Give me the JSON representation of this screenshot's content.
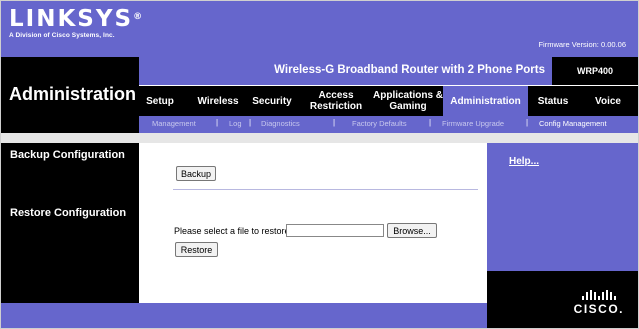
{
  "brand": {
    "logo_text": "LINKSYS",
    "registered": "®",
    "subtitle": "A Division of Cisco Systems, Inc."
  },
  "header": {
    "firmware": "Firmware Version: 0.00.06"
  },
  "product": {
    "name": "Wireless-G Broadband Router with 2 Phone Ports",
    "model": "WRP400"
  },
  "page": {
    "title": "Administration"
  },
  "tabs": [
    {
      "label": "Setup"
    },
    {
      "label": "Wireless"
    },
    {
      "label": "Security"
    },
    {
      "label": "Access Restriction"
    },
    {
      "label": "Applications & Gaming"
    },
    {
      "label": "Administration",
      "active": true
    },
    {
      "label": "Status"
    },
    {
      "label": "Voice"
    }
  ],
  "subtabs": [
    {
      "label": "Management"
    },
    {
      "label": "Log"
    },
    {
      "label": "Diagnostics"
    },
    {
      "label": "Factory Defaults"
    },
    {
      "label": "Firmware Upgrade"
    },
    {
      "label": "Config Management",
      "active": true
    }
  ],
  "sections": {
    "backup": "Backup Configuration",
    "restore": "Restore Configuration"
  },
  "backup": {
    "button_label": "Backup"
  },
  "restore": {
    "prompt": "Please select a file to restore :",
    "file_value": "",
    "browse_label": "Browse...",
    "button_label": "Restore"
  },
  "help": {
    "link": "Help..."
  },
  "footer": {
    "logo_text": "CISCO."
  },
  "colors": {
    "brand_purple": "#6666cc",
    "black": "#000000"
  }
}
